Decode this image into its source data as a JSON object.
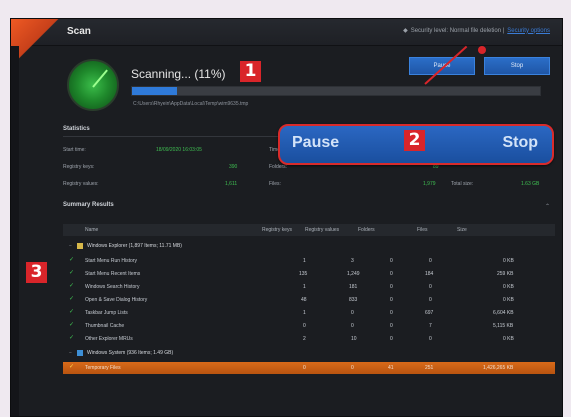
{
  "window": {
    "title": "Scan",
    "security_text": "Security level: Normal file deletion |",
    "security_link": "Security options"
  },
  "scan": {
    "status": "Scanning... (11%)",
    "progress_percent": 11,
    "path": "C:\\Users\\Rhyein\\AppData\\Local\\Temp\\wim9635.tmp"
  },
  "buttons": {
    "pause": "Pause",
    "stop": "Stop"
  },
  "callout": {
    "pause": "Pause",
    "stop": "Stop"
  },
  "badges": {
    "b1": "1",
    "b2": "2",
    "b3": "3"
  },
  "statistics": {
    "title": "Statistics",
    "start_time_label": "Start time:",
    "start_time_value": "18/09/2020 16:03:05",
    "time_label": "Time",
    "registry_keys_label": "Registry keys:",
    "registry_keys_value": "390",
    "folders_label": "Folders:",
    "folders_value": "89",
    "registry_values_label": "Registry values:",
    "registry_values_value": "1,611",
    "files_label": "Files:",
    "files_value": "1,979",
    "total_size_label": "Total size:",
    "total_size_value": "1.63 GB"
  },
  "summary": {
    "title": "Summary Results",
    "columns": [
      "Name",
      "Registry keys",
      "Registry values",
      "Folders",
      "Files",
      "Size"
    ],
    "group1": "Windows Explorer (1,897 Items; 11.71 MB)",
    "rows": [
      {
        "name": "Start Menu Run History",
        "keys": "1",
        "values": "3",
        "folders": "0",
        "files": "0",
        "size": "0 KB"
      },
      {
        "name": "Start Menu Recent Items",
        "keys": "135",
        "values": "1,249",
        "folders": "0",
        "files": "184",
        "size": "259 KB"
      },
      {
        "name": "Windows Search History",
        "keys": "1",
        "values": "181",
        "folders": "0",
        "files": "0",
        "size": "0 KB"
      },
      {
        "name": "Open & Save Dialog History",
        "keys": "48",
        "values": "833",
        "folders": "0",
        "files": "0",
        "size": "0 KB"
      },
      {
        "name": "Taskbar Jump Lists",
        "keys": "1",
        "values": "0",
        "folders": "0",
        "files": "697",
        "size": "6,604 KB"
      },
      {
        "name": "Thumbnail Cache",
        "keys": "0",
        "values": "0",
        "folders": "0",
        "files": "7",
        "size": "5,115 KB"
      },
      {
        "name": "Other Explorer MRUs",
        "keys": "2",
        "values": "10",
        "folders": "0",
        "files": "0",
        "size": "0 KB"
      }
    ],
    "group2": "Windows System (936 Items; 1.49 GB)",
    "highlight_row": {
      "name": "Temporary Files",
      "keys": "0",
      "values": "0",
      "folders": "41",
      "files": "251",
      "size": "1,426,265 KB"
    }
  },
  "colors": {
    "accent": "#ef5a24",
    "button_blue": "#2b6ec8",
    "annotation_red": "#d9252a",
    "progress": "#2f7ad9",
    "highlight_row": "#d86a19"
  }
}
